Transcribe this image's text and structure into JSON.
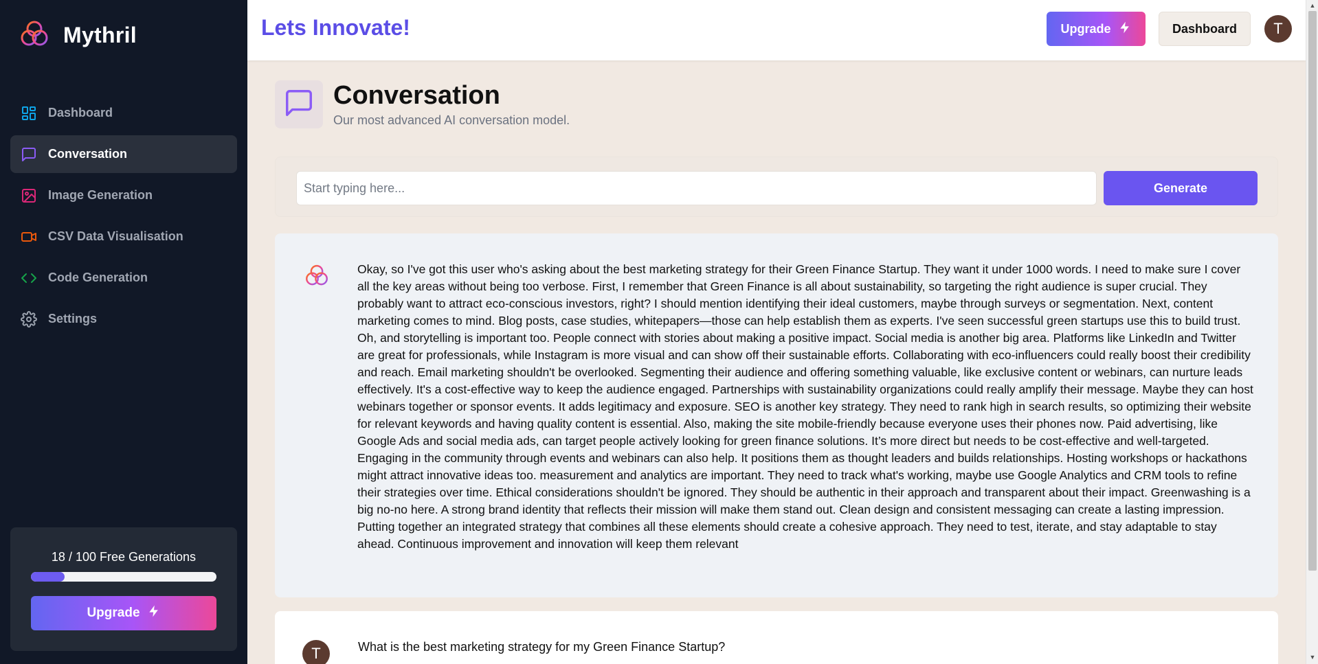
{
  "app": {
    "name": "Mythril"
  },
  "sidebar": {
    "items": [
      {
        "label": "Dashboard",
        "icon": "dashboard-icon",
        "color": "#0ea5e9"
      },
      {
        "label": "Conversation",
        "icon": "chat-icon",
        "color": "#8b5cf6",
        "active": true
      },
      {
        "label": "Image Generation",
        "icon": "image-icon",
        "color": "#db2777"
      },
      {
        "label": "CSV Data Visualisation",
        "icon": "video-icon",
        "color": "#ea580c"
      },
      {
        "label": "Code Generation",
        "icon": "code-icon",
        "color": "#16a34a"
      },
      {
        "label": "Settings",
        "icon": "gear-icon",
        "color": "#9ca3af"
      }
    ],
    "usage": {
      "text": "18 / 100 Free Generations",
      "used": 18,
      "total": 100
    },
    "upgrade_label": "Upgrade"
  },
  "header": {
    "title": "Lets Innovate!",
    "upgrade_label": "Upgrade",
    "dashboard_label": "Dashboard",
    "avatar_initial": "T"
  },
  "page": {
    "title": "Conversation",
    "subtitle": "Our most advanced AI conversation model.",
    "prompt_placeholder": "Start typing here...",
    "prompt_value": "",
    "generate_label": "Generate"
  },
  "messages": [
    {
      "role": "assistant",
      "text": "Okay, so I've got this user who's asking about the best marketing strategy for their Green Finance Startup. They want it under 1000 words. I need to make sure I cover all the key areas without being too verbose. First, I remember that Green Finance is all about sustainability, so targeting the right audience is super crucial. They probably want to attract eco-conscious investors, right? I should mention identifying their ideal customers, maybe through surveys or segmentation. Next, content marketing comes to mind. Blog posts, case studies, whitepapers—those can help establish them as experts. I've seen successful green startups use this to build trust. Oh, and storytelling is important too. People connect with stories about making a positive impact. Social media is another big area. Platforms like LinkedIn and Twitter are great for professionals, while Instagram is more visual and can show off their sustainable efforts. Collaborating with eco-influencers could really boost their credibility and reach. Email marketing shouldn't be overlooked. Segmenting their audience and offering something valuable, like exclusive content or webinars, can nurture leads effectively. It's a cost-effective way to keep the audience engaged. Partnerships with sustainability organizations could really amplify their message. Maybe they can host webinars together or sponsor events. It adds legitimacy and exposure. SEO is another key strategy. They need to rank high in search results, so optimizing their website for relevant keywords and having quality content is essential. Also, making the site mobile-friendly because everyone uses their phones now. Paid advertising, like Google Ads and social media ads, can target people actively looking for green finance solutions. It’s more direct but needs to be cost-effective and well-targeted. Engaging in the community through events and webinars can also help. It positions them as thought leaders and builds relationships. Hosting workshops or hackathons might attract innovative ideas too. measurement and analytics are important. They need to track what's working, maybe use Google Analytics and CRM tools to refine their strategies over time. Ethical considerations shouldn't be ignored. They should be authentic in their approach and transparent about their impact. Greenwashing is a big no-no here. A strong brand identity that reflects their mission will make them stand out. Clean design and consistent messaging can create a lasting impression. Putting together an integrated strategy that combines all these elements should create a cohesive approach. They need to test, iterate, and stay adaptable to stay ahead. Continuous improvement and innovation will keep them relevant"
    },
    {
      "role": "user",
      "avatar_initial": "T",
      "text": "What is the best marketing strategy for my Green Finance Startup?"
    }
  ],
  "colors": {
    "sidebar_bg": "#111827",
    "accent": "#5b4de6",
    "generate_bg": "#6a55f0",
    "page_bg": "#f1e9e2"
  }
}
